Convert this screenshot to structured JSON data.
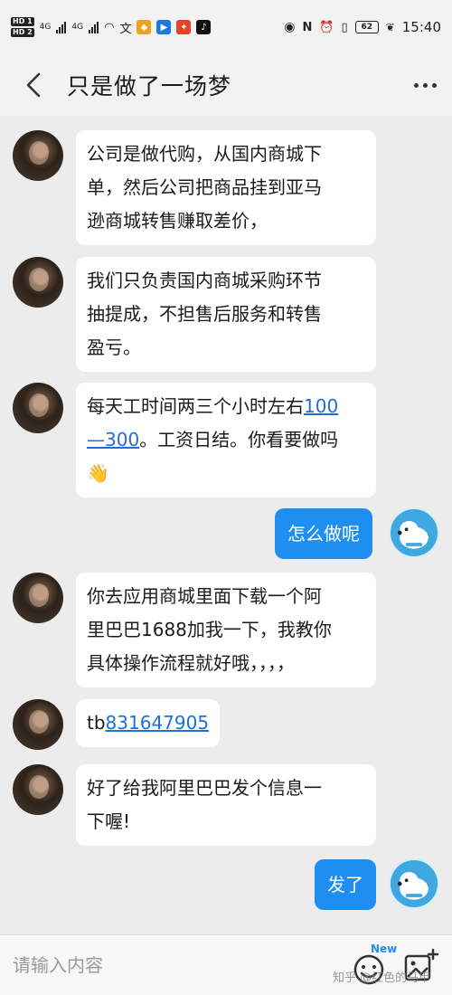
{
  "status_bar": {
    "hd1": "HD 1",
    "hd2": "HD 2",
    "net1": "4G",
    "net2": "4G",
    "battery": "62",
    "time": "15:40"
  },
  "header": {
    "title": "只是做了一场梦"
  },
  "messages": [
    {
      "from": "other",
      "text": "公司是做代购，从国内商城下单，然后公司把商品挂到亚马逊商城转售赚取差价，",
      "lines": [
        "公司是做代购，从国内商城下",
        "单，然后公司把商品挂到亚马",
        "逊商城转售赚取差价，"
      ]
    },
    {
      "from": "other",
      "lines": [
        "我们只负责国内商城采购环节",
        "抽提成，不担售后服务和转售",
        "盈亏。"
      ]
    },
    {
      "from": "other",
      "line1_text": "每天工时间两三个小时左右",
      "link_a": "100",
      "link_b": "—300",
      "line2_text": "。工资日结。你看要做吗",
      "emoji": "👋"
    },
    {
      "from": "me",
      "text": "怎么做呢"
    },
    {
      "from": "other",
      "lines": [
        "你去应用商城里面下载一个阿",
        "里巴巴1688加我一下，我教你",
        "具体操作流程就好哦，，，，"
      ]
    },
    {
      "from": "other",
      "prefix": "tb",
      "link": "831647905"
    },
    {
      "from": "other",
      "lines": [
        "好了给我阿里巴巴发个信息一",
        "下喔!"
      ]
    },
    {
      "from": "me",
      "text": "发了"
    }
  ],
  "input": {
    "placeholder": "请输入内容",
    "new_badge": "New"
  },
  "watermark": "知乎 @红色的马甲",
  "colors": {
    "accent": "#1f8ef1",
    "link": "#1d6fd8",
    "background": "#ececec"
  }
}
